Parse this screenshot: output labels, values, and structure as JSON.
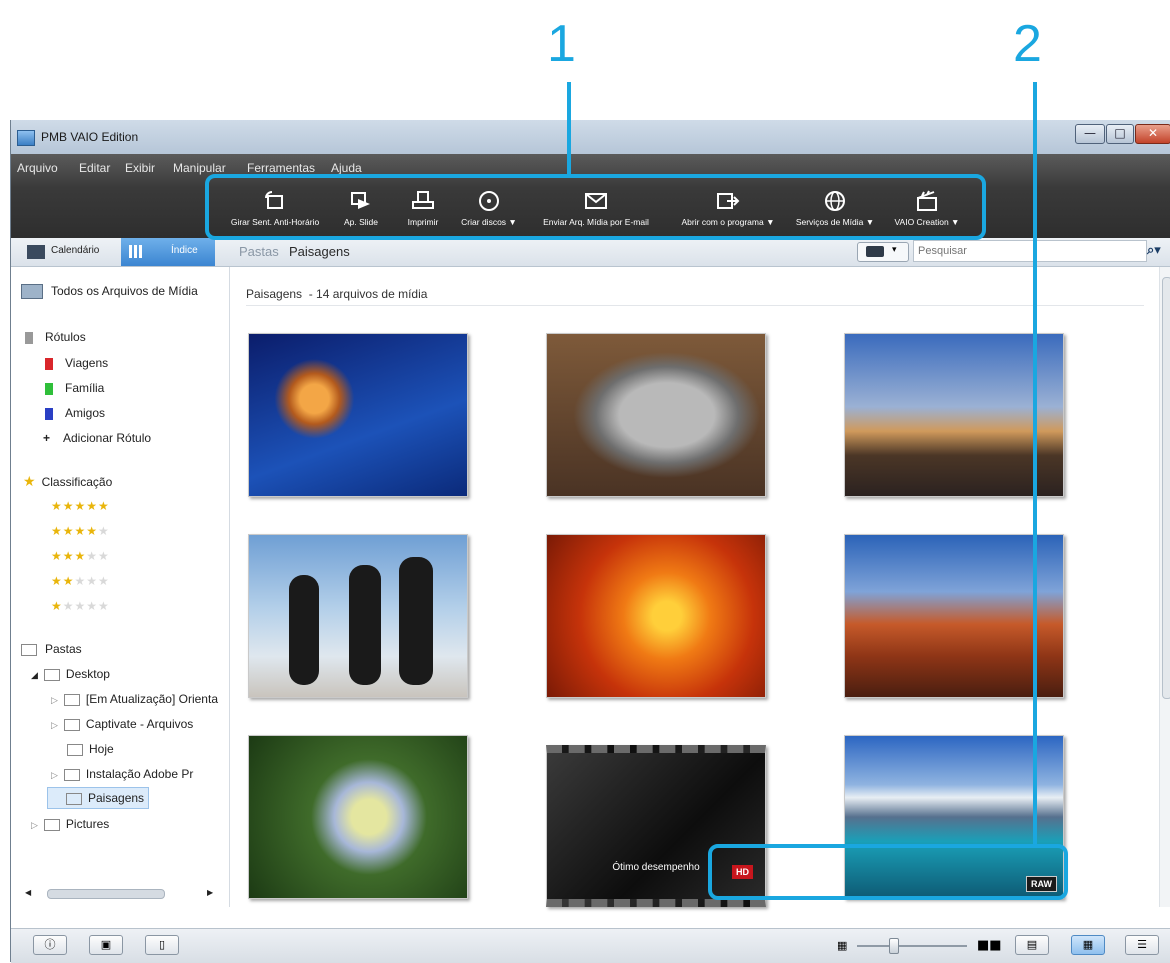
{
  "callouts": [
    "1",
    "2"
  ],
  "window": {
    "title": "PMB VAIO Edition"
  },
  "menu": [
    "Arquivo",
    "Editar",
    "Exibir",
    "Manipular",
    "Ferramentas",
    "Ajuda"
  ],
  "toolbar": {
    "rotate": "Girar Sent. Anti-Horário",
    "slideshow": "Ap. Slide",
    "print": "Imprimir",
    "create_discs": "Criar discos ▼",
    "email": "Enviar Arq. Mídia por E-mail",
    "open_with": "Abrir com o programa ▼",
    "media_services": "Serviços de Mídia ▼",
    "vaio_creation": "VAIO Creation ▼"
  },
  "nav": {
    "calendar_tab": "Calendário",
    "index_tab": "Índice",
    "breadcrumb_root": "Pastas",
    "breadcrumb_current": "Paisagens",
    "search_placeholder": "Pesquisar"
  },
  "sidebar": {
    "all_media": "Todos os Arquivos de Mídia",
    "labels_header": "Rótulos",
    "labels": [
      "Viagens",
      "Família",
      "Amigos"
    ],
    "add_label": "Adicionar Rótulo",
    "rating_header": "Classificação",
    "folders_header": "Pastas",
    "folders": {
      "desktop": "Desktop",
      "children": [
        "[Em Atualização] Orienta",
        "Captivate - Arquivos",
        "Hoje",
        "Instalação Adobe Pr",
        "Paisagens"
      ],
      "pictures": "Pictures"
    }
  },
  "main": {
    "header": "Paisagens  - 14 arquivos de mídia",
    "film_caption": "Ótimo desempenho",
    "badge_hd": "HD",
    "badge_raw": "RAW"
  },
  "colors": {
    "accent": "#1aa7e0",
    "toolbar_bg": "#3a3a3a",
    "label_red": "#d9262b",
    "label_green": "#2fbf3a",
    "label_blue": "#2a3fc4"
  }
}
